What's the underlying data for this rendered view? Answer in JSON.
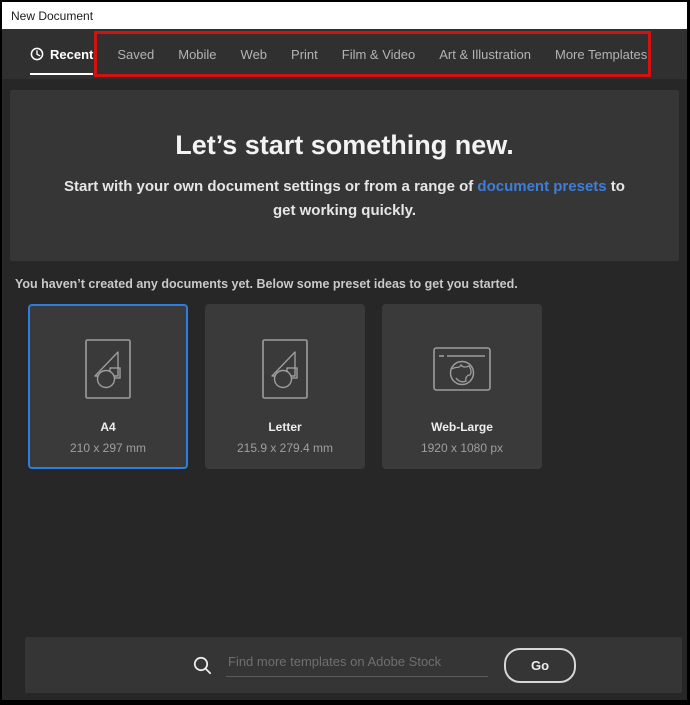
{
  "window": {
    "title": "New Document"
  },
  "tabs": {
    "items": [
      {
        "label": "Recent",
        "active": true,
        "icon": "clock-icon"
      },
      {
        "label": "Saved"
      },
      {
        "label": "Mobile"
      },
      {
        "label": "Web"
      },
      {
        "label": "Print"
      },
      {
        "label": "Film & Video"
      },
      {
        "label": "Art & Illustration"
      },
      {
        "label": "More Templates"
      }
    ]
  },
  "annotation": {
    "shape": "red-rectangle-highlight",
    "color": "#d41111"
  },
  "hero": {
    "title": "Let’s start something new.",
    "subtitle_before": "Start with your own document settings or from a range of ",
    "subtitle_link": "document presets",
    "subtitle_after": " to get working quickly."
  },
  "empty_state": {
    "message": "You haven’t created any documents yet. Below some preset ideas to get you started."
  },
  "presets": [
    {
      "name": "A4",
      "size": "210 x 297 mm",
      "icon": "document-preset-icon",
      "selected": true
    },
    {
      "name": "Letter",
      "size": "215.9 x 279.4 mm",
      "icon": "document-preset-icon",
      "selected": false
    },
    {
      "name": "Web-Large",
      "size": "1920 x 1080 px",
      "icon": "web-globe-icon",
      "selected": false
    }
  ],
  "footer": {
    "search_placeholder": "Find more templates on Adobe Stock",
    "search_icon": "search-icon",
    "go_label": "Go"
  },
  "colors": {
    "accent_link": "#3d7edb",
    "selection_blue": "#2b7fe0",
    "annotation_red": "#d41111"
  }
}
